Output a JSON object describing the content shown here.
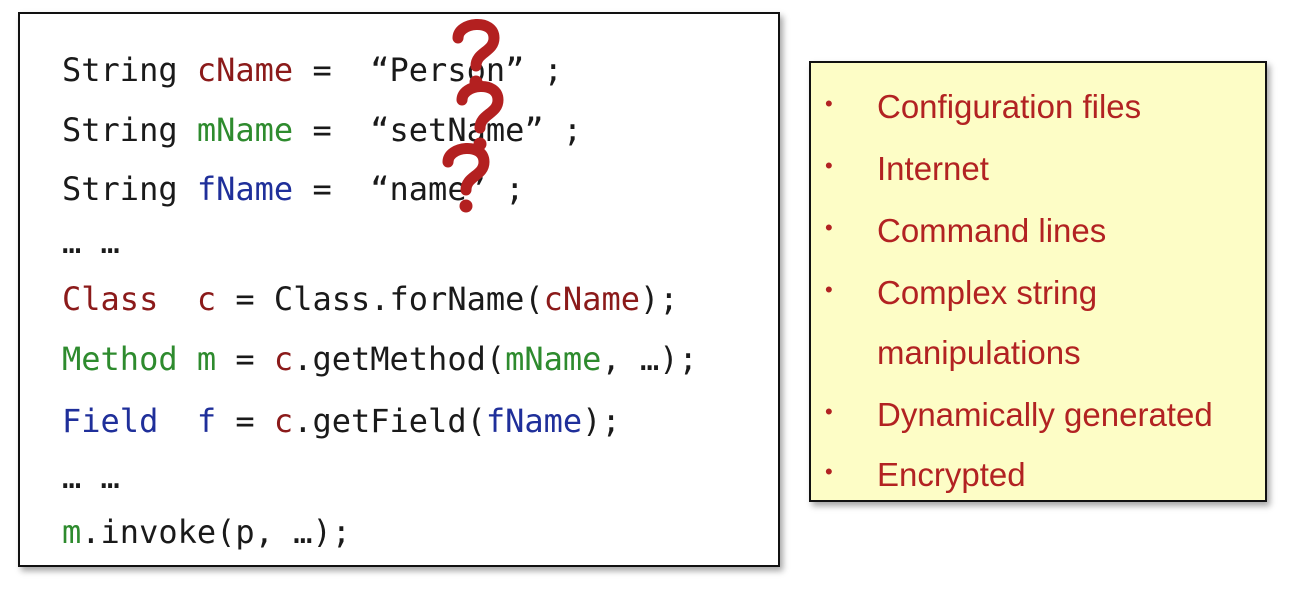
{
  "colors": {
    "class_red": "#8b1a1a",
    "method_green": "#2e8b2e",
    "field_blue": "#1f2f9a",
    "text": "#1a1a1a",
    "list_text": "#b22222",
    "list_bg": "#fdfdc6",
    "question_mark": "#b32020"
  },
  "code": {
    "lines": [
      [
        {
          "t": "String ",
          "c": "text"
        },
        {
          "t": "cName",
          "c": "class_red"
        },
        {
          "t": " =  ",
          "c": "text"
        },
        {
          "t": "“Person”",
          "c": "text"
        },
        {
          "t": " ;",
          "c": "text"
        }
      ],
      [
        {
          "t": "String ",
          "c": "text"
        },
        {
          "t": "mName",
          "c": "method_green"
        },
        {
          "t": " =  ",
          "c": "text"
        },
        {
          "t": "“setName”",
          "c": "text"
        },
        {
          "t": " ;",
          "c": "text"
        }
      ],
      [
        {
          "t": "String ",
          "c": "text"
        },
        {
          "t": "fName",
          "c": "field_blue"
        },
        {
          "t": " =  ",
          "c": "text"
        },
        {
          "t": "“name”",
          "c": "text"
        },
        {
          "t": " ;",
          "c": "text"
        }
      ],
      [
        {
          "t": "… …",
          "c": "text"
        }
      ],
      [
        {
          "t": "Class",
          "c": "class_red"
        },
        {
          "t": "  ",
          "c": "text"
        },
        {
          "t": "c",
          "c": "class_red"
        },
        {
          "t": " = Class.forName(",
          "c": "text"
        },
        {
          "t": "cName",
          "c": "class_red"
        },
        {
          "t": ");",
          "c": "text"
        }
      ],
      [
        {
          "t": "Method",
          "c": "method_green"
        },
        {
          "t": " ",
          "c": "text"
        },
        {
          "t": "m",
          "c": "method_green"
        },
        {
          "t": " = ",
          "c": "text"
        },
        {
          "t": "c",
          "c": "class_red"
        },
        {
          "t": ".getMethod(",
          "c": "text"
        },
        {
          "t": "mName",
          "c": "method_green"
        },
        {
          "t": ", …);",
          "c": "text"
        }
      ],
      [
        {
          "t": "Field",
          "c": "field_blue"
        },
        {
          "t": "  ",
          "c": "text"
        },
        {
          "t": "f",
          "c": "field_blue"
        },
        {
          "t": " = ",
          "c": "text"
        },
        {
          "t": "c",
          "c": "class_red"
        },
        {
          "t": ".getField(",
          "c": "text"
        },
        {
          "t": "fName",
          "c": "field_blue"
        },
        {
          "t": ");",
          "c": "text"
        }
      ],
      [
        {
          "t": "… …",
          "c": "text"
        }
      ],
      [
        {
          "t": "m",
          "c": "method_green"
        },
        {
          "t": ".invoke(p, …);",
          "c": "text"
        }
      ]
    ]
  },
  "question_mark_icon": "question-mark-icon",
  "sources": {
    "items": [
      "Configuration files",
      "Internet",
      "Command lines",
      "Complex string",
      "manipulations",
      "Dynamically generated",
      "Encrypted"
    ],
    "bulleted": [
      true,
      true,
      true,
      true,
      false,
      true,
      true
    ]
  }
}
